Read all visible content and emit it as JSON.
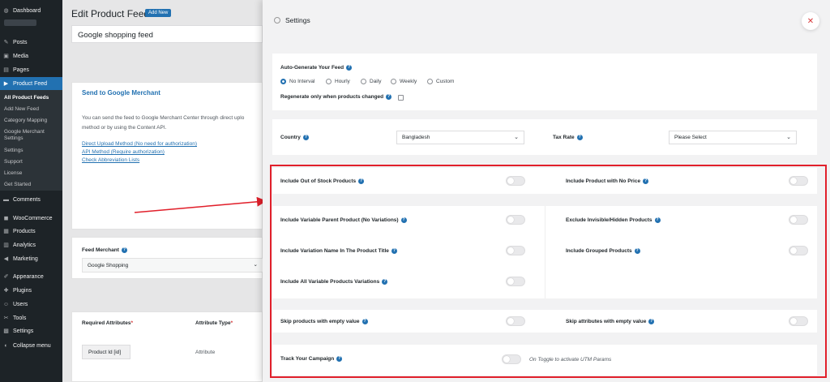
{
  "sidebar": {
    "items": [
      {
        "label": "Dashboard",
        "icon": "dashboard-icon",
        "glyph": "◍"
      },
      {
        "label": "Posts",
        "icon": "pin-icon",
        "glyph": "✎"
      },
      {
        "label": "Media",
        "icon": "media-icon",
        "glyph": "▣"
      },
      {
        "label": "Pages",
        "icon": "pages-icon",
        "glyph": "▤"
      },
      {
        "label": "Product Feed",
        "icon": "product-feed-icon",
        "glyph": "▶"
      },
      {
        "label": "Comments",
        "icon": "comments-icon",
        "glyph": "▬"
      },
      {
        "label": "WooCommerce",
        "icon": "woocommerce-icon",
        "glyph": "◼"
      },
      {
        "label": "Products",
        "icon": "products-icon",
        "glyph": "▦"
      },
      {
        "label": "Analytics",
        "icon": "analytics-icon",
        "glyph": "▥"
      },
      {
        "label": "Marketing",
        "icon": "marketing-icon",
        "glyph": "◀"
      },
      {
        "label": "Appearance",
        "icon": "appearance-icon",
        "glyph": "✐"
      },
      {
        "label": "Plugins",
        "icon": "plugins-icon",
        "glyph": "✚"
      },
      {
        "label": "Users",
        "icon": "users-icon",
        "glyph": "☺"
      },
      {
        "label": "Tools",
        "icon": "tools-icon",
        "glyph": "✂"
      },
      {
        "label": "Settings",
        "icon": "settings-icon",
        "glyph": "▩"
      },
      {
        "label": "Collapse menu",
        "icon": "collapse-icon",
        "glyph": "◐"
      }
    ],
    "submenu": [
      "All Product Feeds",
      "Add New Feed",
      "Category Mapping",
      "Google Merchant Settings",
      "Settings",
      "Support",
      "License",
      "Get Started"
    ]
  },
  "main": {
    "title": "Edit Product Feed",
    "add_new": "Add New",
    "feed_name": "Google shopping feed",
    "merchant_card": {
      "title": "Send to Google Merchant",
      "text1": "You can send the feed to Google Merchant Center through direct uplo",
      "text2": "method or by using the Content API.",
      "link1": "Direct Upload Method (No need for authorization)",
      "link2": "API Method (Require authorization)",
      "link3": "Check Abbreviation Lists"
    },
    "feed_merchant": {
      "label": "Feed Merchant",
      "value": "Google Shopping"
    },
    "attributes": {
      "col1": "Required Attributes",
      "col1_star": "*",
      "col2": "Attribute Type",
      "col2_star": "*",
      "row_attr": "Product Id [id]",
      "row_type": "Attribute"
    }
  },
  "settings": {
    "title": "Settings",
    "close": "✕",
    "auto_generate": {
      "label": "Auto-Generate Your Feed",
      "options": [
        "No Interval",
        "Hourly",
        "Daily",
        "Weekly",
        "Custom"
      ],
      "selected": "No Interval",
      "regen_label": "Regenerate only when products changed"
    },
    "country": {
      "label": "Country",
      "value": "Bangladesh"
    },
    "tax_rate": {
      "label": "Tax Rate",
      "value": "Please Select"
    },
    "toggles": {
      "out_of_stock": "Include Out of Stock Products",
      "no_price": "Include Product with No Price",
      "variable_parent": "Include Variable Parent Product (No Variations)",
      "exclude_hidden": "Exclude Invisible/Hidden Products",
      "variation_name": "Include Variation Name In The Product Title",
      "grouped": "Include Grouped Products",
      "all_variations": "Include All Variable Products Variations",
      "skip_empty": "Skip products with empty value",
      "skip_attr_empty": "Skip attributes with empty value",
      "track_campaign": "Track Your Campaign",
      "utm_hint": "On Toggle to activate UTM Params"
    }
  },
  "colors": {
    "accent": "#2271b1",
    "highlight": "#e1202b",
    "sidebar": "#1d2327"
  }
}
